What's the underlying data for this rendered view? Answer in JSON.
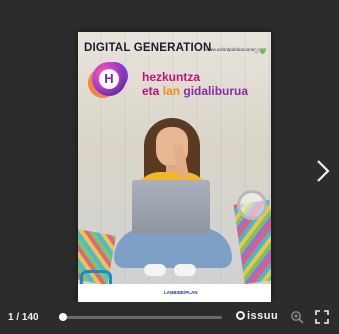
{
  "viewer": {
    "page_counter": "1 / 140",
    "current_page": 1,
    "total_pages": 140,
    "progress_fraction": 0.007,
    "brand": "issuu"
  },
  "cover": {
    "header": "DIGITAL GENERATION",
    "url": "www.oxfordpublicaciones.com",
    "badge_letter": "H",
    "title_line1": "hezkuntza",
    "title_line2_w1": "eta",
    "title_line2_w2": "lan",
    "title_line2_w3": "gidaliburua",
    "footer_logo_left": "",
    "footer_logo_mid": "LANBIDE/PLAN",
    "footer_logo_right": ""
  },
  "icons": {
    "next": "chevron-right-icon",
    "zoom": "zoom-in-icon",
    "fullscreen": "fullscreen-icon",
    "brand": "issuu-logo-icon"
  },
  "colors": {
    "background": "#2c2c2c",
    "title_pink": "#c2127a",
    "title_orange": "#f28c1c",
    "title_purple": "#8a2aa8"
  }
}
